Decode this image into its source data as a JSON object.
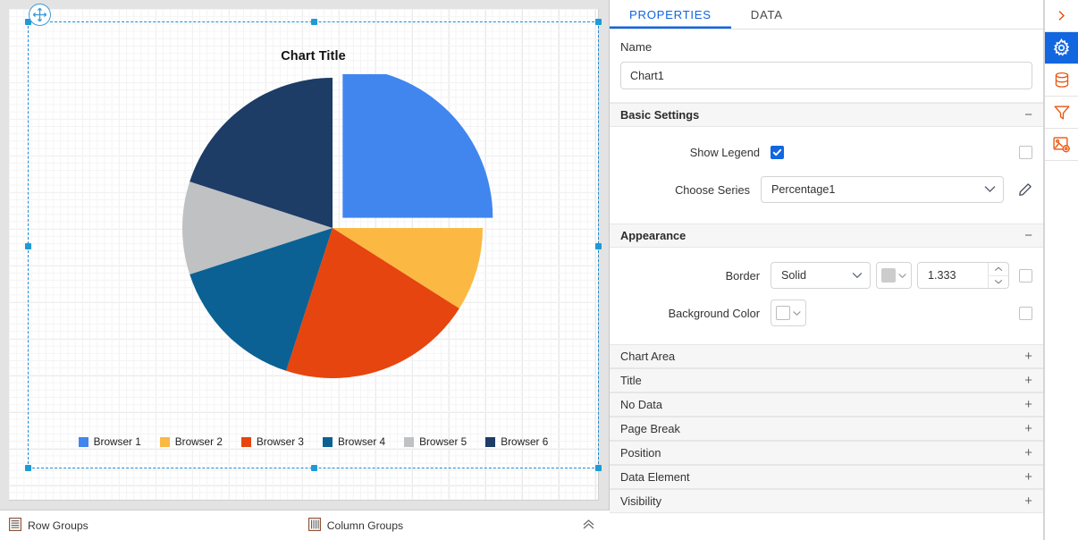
{
  "designer": {
    "chart_title": "Chart Title",
    "move_handle_icon": "move-icon",
    "statusbar": {
      "row_groups_label": "Row Groups",
      "row_groups_icon": "row-groups-icon",
      "column_groups_label": "Column Groups",
      "column_groups_icon": "column-groups-icon",
      "collapse_icon": "chevron-up-icon"
    }
  },
  "chart_data": {
    "type": "pie",
    "title": "Chart Title",
    "legend_position": "bottom",
    "exploded_slice": "Browser 1",
    "categories": [
      "Browser 1",
      "Browser 2",
      "Browser 3",
      "Browser 4",
      "Browser 5",
      "Browser 6"
    ],
    "values": [
      25,
      9,
      21,
      15,
      10,
      20
    ],
    "colors": [
      "#4186ef",
      "#fbb943",
      "#e6450f",
      "#0b6193",
      "#bfc1c3",
      "#1d3c66"
    ],
    "series_name": "Percentage1",
    "xlabel": "",
    "ylabel": ""
  },
  "panel": {
    "tabs": [
      {
        "label": "PROPERTIES",
        "active": true
      },
      {
        "label": "DATA",
        "active": false
      }
    ],
    "name": {
      "label": "Name",
      "value": "Chart1",
      "placeholder": "Name"
    },
    "sections": {
      "basic_settings": {
        "title": "Basic Settings",
        "sign": "−",
        "show_legend": {
          "label": "Show Legend",
          "checked": true,
          "expression_checked": false
        },
        "choose_series": {
          "label": "Choose Series",
          "value": "Percentage1",
          "dropdown_icon": "chevron-down-icon",
          "edit_icon": "pencil-icon"
        }
      },
      "appearance": {
        "title": "Appearance",
        "sign": "−",
        "border": {
          "label": "Border",
          "style_value": "Solid",
          "color_value": "#cccccc",
          "width_value": "1.333",
          "expression_checked": false
        },
        "background_color": {
          "label": "Background Color",
          "color_value": "#ffffff",
          "expression_checked": false
        }
      }
    },
    "collapsed_sections": [
      {
        "title": "Chart Area",
        "sign": "+"
      },
      {
        "title": "Title",
        "sign": "+"
      },
      {
        "title": "No Data",
        "sign": "+"
      },
      {
        "title": "Page Break",
        "sign": "+"
      },
      {
        "title": "Position",
        "sign": "+"
      },
      {
        "title": "Data Element",
        "sign": "+"
      },
      {
        "title": "Visibility",
        "sign": "+"
      }
    ]
  },
  "rail": {
    "items": [
      {
        "icon": "chevron-right-icon",
        "active": false
      },
      {
        "icon": "gear-icon",
        "active": true
      },
      {
        "icon": "database-icon",
        "active": false
      },
      {
        "icon": "filter-icon",
        "active": false
      },
      {
        "icon": "chart-settings-icon",
        "active": false
      }
    ]
  },
  "colors": {
    "accent": "#1266e0",
    "rail_icon": "#e8550d",
    "selection": "#1e8ad6"
  }
}
